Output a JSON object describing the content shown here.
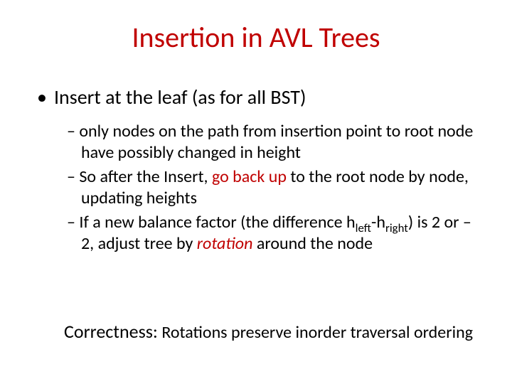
{
  "title": "Insertion in AVL Trees",
  "l1": {
    "bullet": "•",
    "text": "Insert at the leaf (as for all BST)"
  },
  "l2": {
    "dash": "–",
    "items": [
      {
        "pre": "only nodes on the path from insertion point to root node have possibly changed in height"
      },
      {
        "pre": "So after the Insert, ",
        "red": "go back up",
        "post": " to the root node by node, updating heights"
      },
      {
        "pre": "If a new balance factor (the difference h",
        "sub1": "left",
        "mid": "-h",
        "sub2": "right",
        "post1": ") is 2 or –2, adjust tree by ",
        "rot": "rotation",
        "post2": " around the node"
      }
    ]
  },
  "correctness": {
    "label": "Correctness:",
    "text": "  Rotations preserve inorder traversal ordering"
  }
}
